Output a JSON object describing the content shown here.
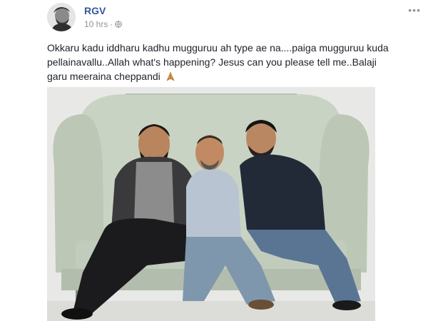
{
  "post": {
    "author": "RGV",
    "time": "10 hrs",
    "dot": "·",
    "more": "•••",
    "text": "Okkaru kadu iddharu kadhu mugguruu ah type ae na....paiga mugguruu kuda pellainavallu..Allah what's happening? Jesus can you please tell me..Balaji garu meeraina cheppandi",
    "privacy_icon": "globe-icon",
    "text_emoji": "praying-emoji"
  },
  "colors": {
    "author_link": "#365899",
    "meta_gray": "#90949c",
    "text": "#1d2129",
    "sofa": "#c9d3c4"
  }
}
